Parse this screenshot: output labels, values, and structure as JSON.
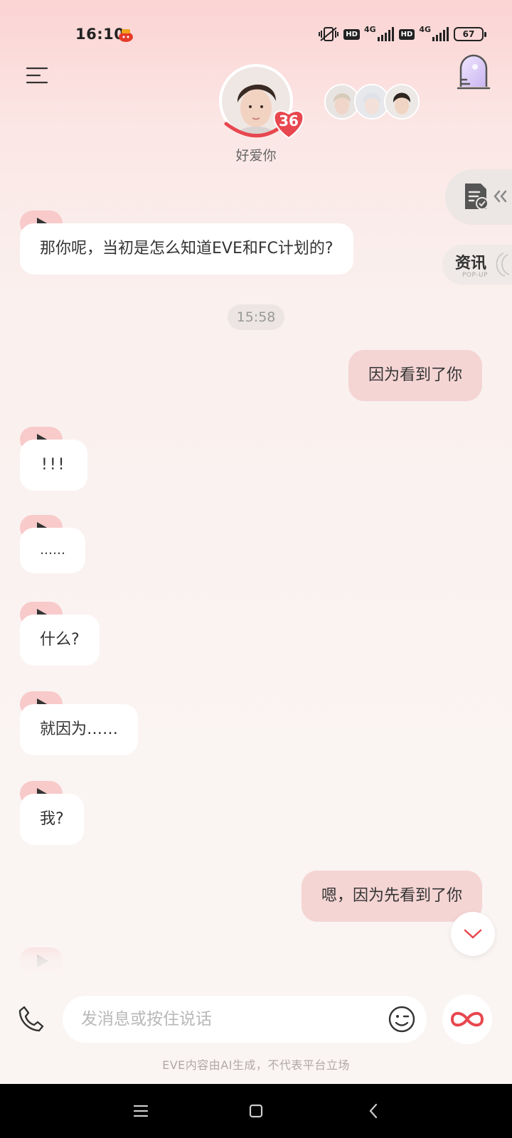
{
  "status_bar": {
    "time": "16:10",
    "hd1": "HD",
    "net1": "4G",
    "hd2": "HD",
    "net2": "4G",
    "battery": "67"
  },
  "header": {
    "affinity": "36",
    "status_text": "好爱你"
  },
  "side": {
    "news_title": "资讯",
    "news_sub": "POP-UP"
  },
  "messages": {
    "m1": "那你呢，当初是怎么知道EVE和FC计划的?",
    "timestamp": "15:58",
    "m2": "因为看到了你",
    "m3": "!!!",
    "m4": "……",
    "m5": "什么?",
    "m6": "就因为……",
    "m7": "我?",
    "m8": "嗯，因为先看到了你"
  },
  "input": {
    "placeholder": "发消息或按住说话"
  },
  "footer": {
    "disclaimer": "EVE内容由AI生成，不代表平台立场"
  },
  "colors": {
    "accent": "#e8474f",
    "bubble_self": "#f4d5d4",
    "play_bg": "#f8caca"
  },
  "icons": [
    "menu-icon",
    "heart-icon",
    "door-icon",
    "checklist-icon",
    "phone-icon",
    "emoji-icon",
    "infinity-icon",
    "chevron-down-icon"
  ]
}
